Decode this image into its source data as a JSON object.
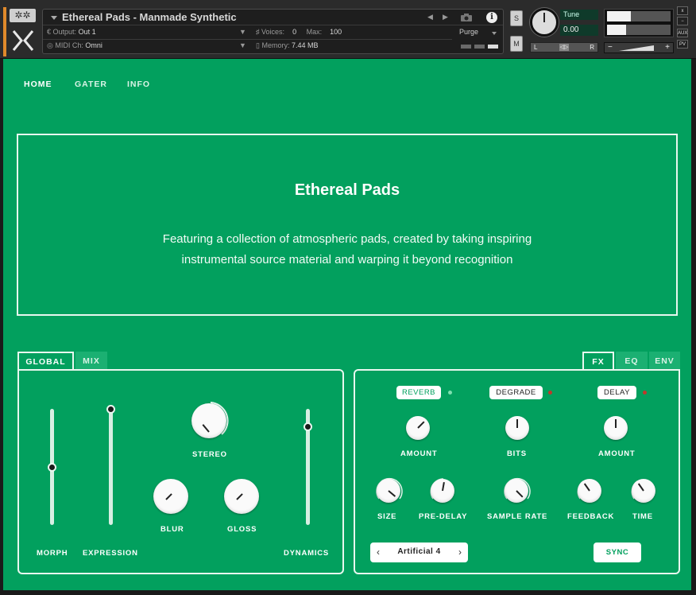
{
  "header": {
    "instrument_title": "Ethereal Pads - Manmade Synthetic",
    "output_label": "Output:",
    "output_value": "Out 1",
    "voices_label": "Voices:",
    "voices_value": "0",
    "max_label": "Max:",
    "max_value": "100",
    "midi_label": "MIDI Ch:",
    "midi_value": "Omni",
    "memory_label": "Memory:",
    "memory_value": "7.44 MB",
    "purge_label": "Purge",
    "solo_label": "S",
    "mute_label": "M",
    "tune_label": "Tune",
    "tune_value": "0.00",
    "pan_left": "L",
    "pan_right": "R",
    "aux_label": "AUX",
    "pv_label": "PV",
    "close_label": "x",
    "minimize_label": "−",
    "vol_minus": "−",
    "vol_plus": "+"
  },
  "nav": {
    "items": [
      "HOME",
      "GATER",
      "INFO"
    ],
    "active": "HOME"
  },
  "description": {
    "title": "Ethereal Pads",
    "line1": "Featuring a collection of atmospheric pads, created by taking inspiring",
    "line2": "instrumental source material and warping it beyond recognition"
  },
  "left_panel": {
    "tabs": [
      "GLOBAL",
      "MIX"
    ],
    "active_tab": "GLOBAL",
    "sliders": {
      "morph": {
        "label": "MORPH",
        "value": 0.5
      },
      "expression": {
        "label": "EXPRESSION",
        "value": 1.0
      },
      "dynamics": {
        "label": "DYNAMICS",
        "value": 0.85
      }
    },
    "knobs": {
      "stereo": {
        "label": "STEREO"
      },
      "blur": {
        "label": "BLUR"
      },
      "gloss": {
        "label": "GLOSS"
      }
    }
  },
  "right_panel": {
    "tabs": [
      "FX",
      "EQ",
      "ENV"
    ],
    "active_tab": "FX",
    "modules": {
      "reverb": {
        "label": "REVERB",
        "enabled": true
      },
      "degrade": {
        "label": "DEGRADE",
        "enabled": false
      },
      "delay": {
        "label": "DELAY",
        "enabled": false
      }
    },
    "knob_labels": {
      "reverb_amount": "AMOUNT",
      "bits": "BITS",
      "delay_amount": "AMOUNT",
      "size": "SIZE",
      "pre_delay": "PRE-DELAY",
      "sample_rate": "SAMPLE RATE",
      "feedback": "FEEDBACK",
      "time": "TIME"
    },
    "preset": "Artificial 4",
    "sync_label": "SYNC"
  },
  "colors": {
    "background": "#02a05e",
    "accent": "#02a05e",
    "panel_border": "#e8f7ef",
    "dot_on": "#7ee0b0",
    "dot_off": "#c0392b",
    "header_bg": "#2b2b2b"
  }
}
